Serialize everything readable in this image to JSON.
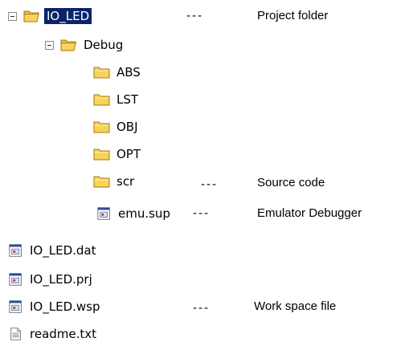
{
  "tree": {
    "root": {
      "label": "IO_LED",
      "icon": "folder-open-icon"
    },
    "debug": {
      "label": "Debug",
      "icon": "folder-open-icon"
    },
    "abs": {
      "label": "ABS",
      "icon": "folder-icon"
    },
    "lst": {
      "label": "LST",
      "icon": "folder-icon"
    },
    "obj": {
      "label": "OBJ",
      "icon": "folder-icon"
    },
    "opt": {
      "label": "OPT",
      "icon": "folder-icon"
    },
    "scr": {
      "label": "scr",
      "icon": "folder-icon"
    },
    "emu": {
      "label": "emu.sup",
      "icon": "app-file-icon"
    },
    "dat": {
      "label": "IO_LED.dat",
      "icon": "app-file-icon"
    },
    "prj": {
      "label": "IO_LED.prj",
      "icon": "app-file-icon"
    },
    "wsp": {
      "label": "IO_LED.wsp",
      "icon": "app-file-icon"
    },
    "readme": {
      "label": "readme.txt",
      "icon": "text-file-icon"
    }
  },
  "annotations": {
    "separator": "---",
    "project_folder": "Project folder",
    "source_code": "Source code",
    "emulator_debugger": "Emulator Debugger",
    "work_space_file": "Work space file"
  },
  "colors": {
    "selection_bg": "#0a246a",
    "folder_fill": "#f7d35a",
    "folder_border": "#b8860b"
  }
}
